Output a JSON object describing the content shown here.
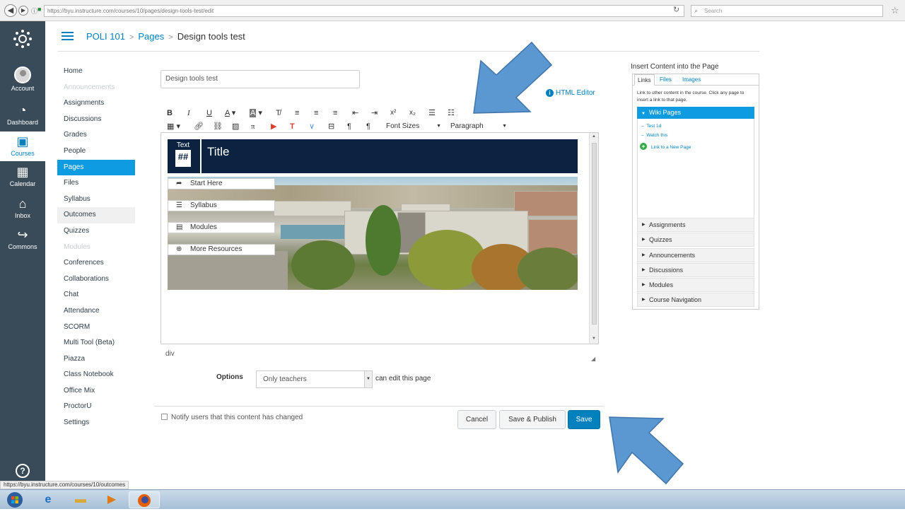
{
  "browser": {
    "url": "https://byu.instructure.com/courses/10/pages/design-tools-test/edit",
    "search_placeholder": "Search"
  },
  "global_nav": [
    {
      "id": "account",
      "label": "Account",
      "icon": "avatar-icon"
    },
    {
      "id": "dashboard",
      "label": "Dashboard",
      "icon": "speedometer-icon"
    },
    {
      "id": "courses",
      "label": "Courses",
      "icon": "book-icon",
      "active": true
    },
    {
      "id": "calendar",
      "label": "Calendar",
      "icon": "calendar-icon"
    },
    {
      "id": "inbox",
      "label": "Inbox",
      "icon": "inbox-icon"
    },
    {
      "id": "commons",
      "label": "Commons",
      "icon": "commons-icon"
    }
  ],
  "breadcrumb": {
    "course": "POLI 101",
    "section": "Pages",
    "page": "Design tools test"
  },
  "course_nav": [
    {
      "label": "Home"
    },
    {
      "label": "Announcements",
      "state": "muted"
    },
    {
      "label": "Assignments"
    },
    {
      "label": "Discussions"
    },
    {
      "label": "Grades"
    },
    {
      "label": "People"
    },
    {
      "label": "Pages",
      "state": "active"
    },
    {
      "label": "Files"
    },
    {
      "label": "Syllabus"
    },
    {
      "label": "Outcomes",
      "state": "hover"
    },
    {
      "label": "Quizzes"
    },
    {
      "label": "Modules",
      "state": "muted"
    },
    {
      "label": "Conferences"
    },
    {
      "label": "Collaborations"
    },
    {
      "label": "Chat"
    },
    {
      "label": "Attendance"
    },
    {
      "label": "SCORM"
    },
    {
      "label": "Multi Tool (Beta)"
    },
    {
      "label": "Piazza"
    },
    {
      "label": "Class Notebook"
    },
    {
      "label": "Office Mix"
    },
    {
      "label": "ProctorU"
    },
    {
      "label": "Settings"
    }
  ],
  "editor": {
    "title_value": "Design tools test",
    "html_editor_link": "HTML Editor",
    "font_sizes_label": "Font Sizes",
    "paragraph_label": "Paragraph",
    "banner_logo_text": "Text",
    "banner_logo_symbol": "##",
    "banner_title": "Title",
    "links": [
      "Start Here",
      "Syllabus",
      "Modules",
      "More Resources"
    ],
    "path": "div"
  },
  "options": {
    "label": "Options",
    "edit_permission": "Only teachers",
    "suffix": "can edit this page"
  },
  "footer": {
    "notify_label": "Notify users that this content has changed",
    "cancel": "Cancel",
    "save_publish": "Save & Publish",
    "save": "Save"
  },
  "sidebar": {
    "title": "Insert Content into the Page",
    "tabs": [
      "Links",
      "Files",
      "Images"
    ],
    "hint": "Link to other content in the course. Click any page to insert a link to that page.",
    "wiki_pages": "Wiki Pages",
    "wiki_items": [
      "Test 1d",
      "Watch this"
    ],
    "new_page": "Link to a New Page",
    "sections": [
      "Assignments",
      "Quizzes",
      "Announcements",
      "Discussions",
      "Modules",
      "Course Navigation"
    ]
  },
  "status_url": "https://byu.instructure.com/courses/10/outcomes",
  "colors": {
    "canvas_nav": "#394b58",
    "accent": "#0081bd",
    "active_item": "#0f9be0",
    "banner": "#0b2341",
    "arrow": "#5b97d1"
  }
}
